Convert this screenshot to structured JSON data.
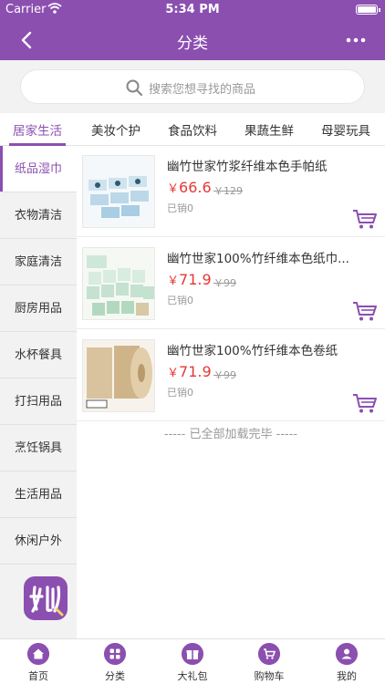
{
  "statusbar": {
    "carrier": "Carrier",
    "time": "5:34 PM"
  },
  "navbar": {
    "title": "分类"
  },
  "search": {
    "placeholder": "搜索您想寻找的商品"
  },
  "tabs": [
    {
      "label": "居家生活",
      "active": true
    },
    {
      "label": "美妆个护"
    },
    {
      "label": "食品饮料"
    },
    {
      "label": "果蔬生鲜"
    },
    {
      "label": "母婴玩具"
    }
  ],
  "sidebar": [
    {
      "label": "纸品湿巾",
      "active": true
    },
    {
      "label": "衣物清洁"
    },
    {
      "label": "家庭清洁"
    },
    {
      "label": "厨房用品"
    },
    {
      "label": "水杯餐具"
    },
    {
      "label": "打扫用品"
    },
    {
      "label": "烹饪锅具"
    },
    {
      "label": "生活用品"
    },
    {
      "label": "休闲户外"
    }
  ],
  "products": [
    {
      "name": "幽竹世家竹浆纤维本色手帕纸",
      "currency": "￥",
      "price": "66.6",
      "orig_price": "￥129",
      "sold": "已销0"
    },
    {
      "name": "幽竹世家100%竹纤维本色纸巾...",
      "currency": "￥",
      "price": "71.9",
      "orig_price": "￥99",
      "sold": "已销0"
    },
    {
      "name": "幽竹世家100%竹纤维本色卷纸",
      "currency": "￥",
      "price": "71.9",
      "orig_price": "￥99",
      "sold": "已销0"
    }
  ],
  "list_end": "----- 已全部加载完毕 -----",
  "tabbar": [
    {
      "label": "首页",
      "icon": "home-icon"
    },
    {
      "label": "分类",
      "icon": "category-icon"
    },
    {
      "label": "大礼包",
      "icon": "gift-icon"
    },
    {
      "label": "购物车",
      "icon": "cart-icon"
    },
    {
      "label": "我的",
      "icon": "user-icon"
    }
  ],
  "colors": {
    "accent": "#8b4fb0",
    "price": "#e53935"
  }
}
